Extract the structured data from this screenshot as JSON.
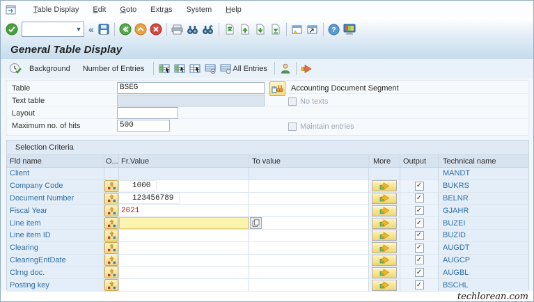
{
  "menu": {
    "items": [
      {
        "label": "Table Display",
        "u": 0
      },
      {
        "label": "Edit",
        "u": 0
      },
      {
        "label": "Goto",
        "u": 0
      },
      {
        "label": "Extras",
        "u": 4
      },
      {
        "label": "System",
        "u": -1
      },
      {
        "label": "Help",
        "u": 0
      }
    ]
  },
  "toolbar": {
    "command_value": "",
    "icons": [
      "enter-icon",
      "command-dropdown-icon",
      "collapse-icon",
      "save-icon",
      "back-icon",
      "exit-icon",
      "cancel-icon",
      "print-icon",
      "find-icon",
      "find-next-icon",
      "first-page-icon",
      "previous-page-icon",
      "next-page-icon",
      "last-page-icon",
      "new-session-icon",
      "shortcut-icon",
      "help-icon",
      "layout-icon"
    ]
  },
  "header": {
    "title": "General Table Display"
  },
  "app_toolbar": {
    "execute_icon": "execute-background-icon",
    "background": "Background",
    "number_of_entries": "Number of Entries",
    "all_entries": "All Entries",
    "icons": [
      "table-contents-icon",
      "select-entries-icon",
      "display-entries-icon",
      "delete-entries-icon",
      "all-entries-icon",
      "user-settings-icon",
      "end-session-icon"
    ]
  },
  "form": {
    "rows": [
      {
        "label": "Table",
        "value": "BSEG"
      },
      {
        "label": "Text table",
        "value": ""
      },
      {
        "label": "Layout",
        "value": ""
      },
      {
        "label": "Maximum no. of hits",
        "value": "500"
      }
    ],
    "table_description": "Accounting Document Segment",
    "no_texts": "No texts",
    "maintain_entries": "Maintain entries"
  },
  "selection": {
    "title": "Selection Criteria",
    "columns": [
      "Fld name",
      "O...",
      "Fr.Value",
      "To value",
      "More",
      "Output",
      "Technical name"
    ],
    "rows": [
      {
        "field": "Client",
        "tech": "MANDT",
        "option": false,
        "more": false,
        "output": false,
        "value": "",
        "style": "readonly"
      },
      {
        "field": "Company Code",
        "tech": "BUKRS",
        "option": true,
        "more": true,
        "output": true,
        "value": "1000",
        "style": "boxed"
      },
      {
        "field": "Document Number",
        "tech": "BELNR",
        "option": true,
        "more": true,
        "output": true,
        "value": "123456789",
        "style": "boxed"
      },
      {
        "field": "Fiscal Year",
        "tech": "GJAHR",
        "option": true,
        "more": true,
        "output": true,
        "value": "2021",
        "style": "red"
      },
      {
        "field": "Line item",
        "tech": "BUZEI",
        "option": true,
        "more": true,
        "output": true,
        "value": "",
        "style": "focused"
      },
      {
        "field": "Line item ID",
        "tech": "BUZID",
        "option": true,
        "more": true,
        "output": true,
        "value": "",
        "style": ""
      },
      {
        "field": "Clearing",
        "tech": "AUGDT",
        "option": true,
        "more": true,
        "output": true,
        "value": "",
        "style": ""
      },
      {
        "field": "ClearingEntDate",
        "tech": "AUGCP",
        "option": true,
        "more": true,
        "output": true,
        "value": "",
        "style": ""
      },
      {
        "field": "Clrng doc.",
        "tech": "AUGBL",
        "option": true,
        "more": true,
        "output": true,
        "value": "",
        "style": ""
      },
      {
        "field": "Posting key",
        "tech": "BSCHL",
        "option": true,
        "more": true,
        "output": true,
        "value": "",
        "style": ""
      }
    ]
  },
  "watermark": "techlorean.com",
  "colors": {
    "accent_yellow": "#f2da7e",
    "focus_yellow": "#fcf3ae",
    "link_blue": "#2e6da4",
    "value_red": "#b3261e"
  }
}
